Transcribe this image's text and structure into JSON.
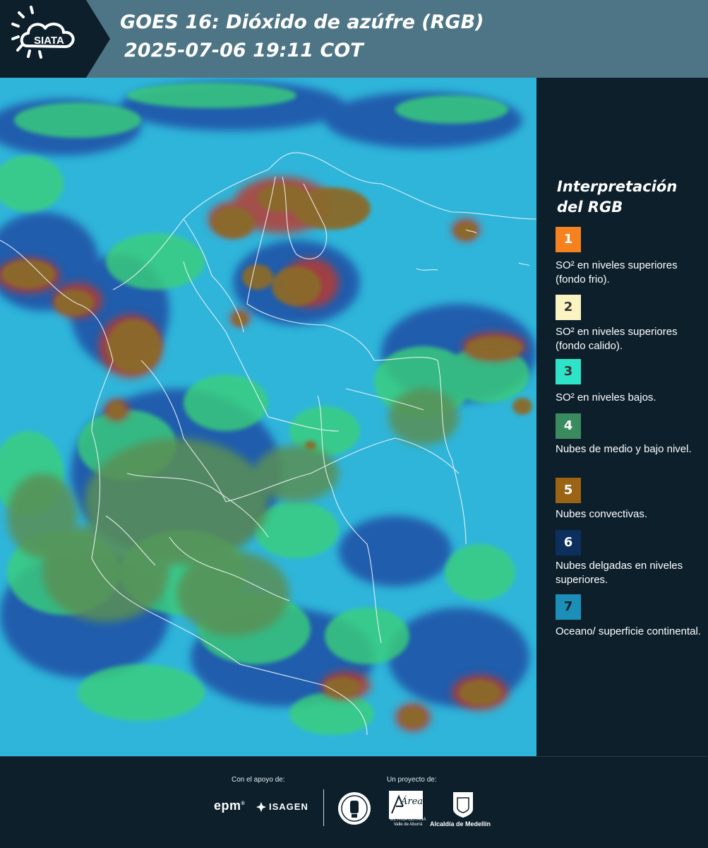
{
  "header": {
    "logo_text": "SIATA",
    "title_line1": "GOES 16: Dióxido de azúfre (RGB)",
    "title_line2": "2025-07-06 19:11 COT"
  },
  "map": {
    "colors": {
      "background": "#2fb5da",
      "low_cloud": "#3bd07a",
      "mid_cloud": "#5a8f55",
      "thin_cloud": "#1c3f9e",
      "convective": "#8a6a2a",
      "convective_edge": "#c0392b",
      "border": "#f2f6f8"
    }
  },
  "legend": {
    "title": "Interpretación del RGB",
    "items": [
      {
        "number": "1",
        "color": "#f5821f",
        "text_color": "#ffffff",
        "label": "SO² en niveles superiores (fondo frio)."
      },
      {
        "number": "2",
        "color": "#fbf3c1",
        "text_color": "#333333",
        "label": "SO² en niveles superiores (fondo calido)."
      },
      {
        "number": "3",
        "color": "#2fe3c8",
        "text_color": "#333333",
        "label": "SO² en niveles bajos."
      },
      {
        "number": "4",
        "color": "#3a8c5e",
        "text_color": "#ffffff",
        "label": "Nubes de medio y bajo nivel."
      },
      {
        "number": "5",
        "color": "#9a6414",
        "text_color": "#ffffff",
        "label": "Nubes convectivas."
      },
      {
        "number": "6",
        "color": "#0c2f5e",
        "text_color": "#ffffff",
        "label": "Nubes delgadas en niveles superiores."
      },
      {
        "number": "7",
        "color": "#1b8fb8",
        "text_color": "#0c1f2b",
        "label": "Oceano/ superficie continental."
      }
    ]
  },
  "footer": {
    "support_label": "Con el apoyo de:",
    "project_label": "Un proyecto de:",
    "epm": "epm",
    "isagen": "ISAGEN",
    "area_logo": "Área",
    "area_sub": "METROPOLITANA Valle de Aburrá",
    "alcaldia": "Alcaldía de Medellín"
  }
}
